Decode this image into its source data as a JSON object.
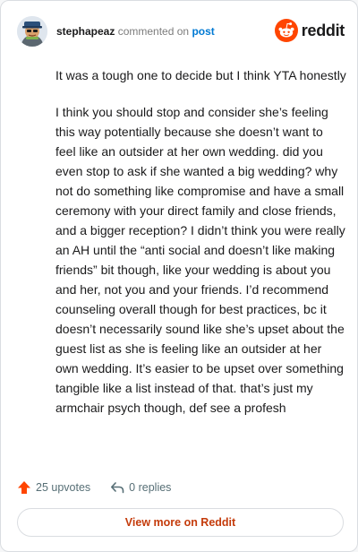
{
  "comment": {
    "author": "stephapeaz",
    "action": "commented on",
    "target": "post",
    "paragraphs": [
      "It was a tough one to decide but I think YTA honestly",
      "I think you should stop and consider she’s feeling this way potentially because she doesn’t want to feel like an outsider at her own wedding. did you even stop to ask if she wanted a big wedding? why not do something like compromise and have a small ceremony with your direct family and close friends, and a bigger reception? I didn’t think you were really an AH until the “anti social and doesn’t like making friends” bit though, like your wedding is about you and her, not you and your friends. I’d recommend counseling overall though for best practices, bc it doesn’t necessarily sound like she’s upset about the guest list as she is feeling like an outsider at her own wedding. It’s easier to be upset over something tangible like a list instead of that. that’s just my armchair psych though, def see a profesh"
    ]
  },
  "brand": {
    "wordmark": "reddit",
    "logo_icon": "reddit-snoo-icon",
    "color": "#ff4500"
  },
  "stats": {
    "upvotes": "25 upvotes",
    "upvote_icon": "upvote-arrow-icon",
    "upvote_color": "#ff4500",
    "replies": "0 replies",
    "reply_icon": "reply-arrow-icon"
  },
  "cta": {
    "label": "View more on Reddit",
    "color": "#c43b0b"
  },
  "colors": {
    "link": "#0079d3",
    "muted": "#7c7c7c"
  }
}
